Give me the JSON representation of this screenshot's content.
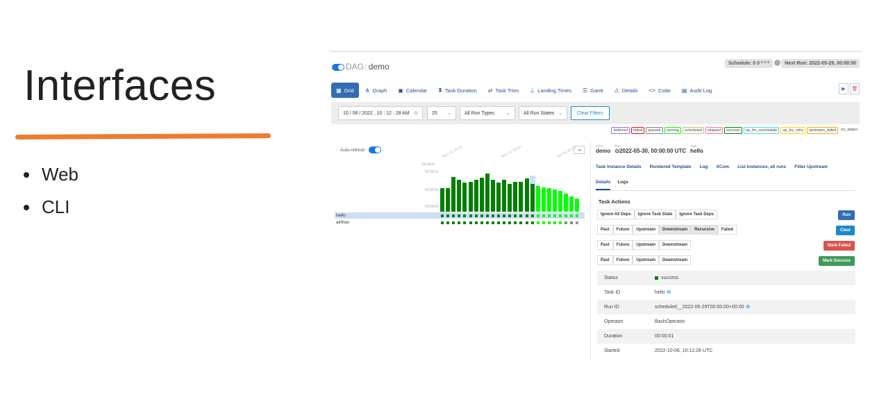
{
  "slide": {
    "title": "Interfaces",
    "bullets": [
      "Web",
      "CLI"
    ],
    "accent_color": "#ec7c30"
  },
  "airflow": {
    "dag_label": "DAG:",
    "dag_name": "demo",
    "schedule": "Schedule: 0 0 * * *",
    "next_run": "Next Run: 2022-05-29, 00:00:00",
    "nav": [
      {
        "label": "Grid",
        "icon": "grid-icon",
        "active": true
      },
      {
        "label": "Graph",
        "icon": "graph-icon"
      },
      {
        "label": "Calendar",
        "icon": "calendar-icon"
      },
      {
        "label": "Task Duration",
        "icon": "hourglass-icon"
      },
      {
        "label": "Task Tries",
        "icon": "retry-icon"
      },
      {
        "label": "Landing Times",
        "icon": "landing-icon"
      },
      {
        "label": "Gantt",
        "icon": "gantt-icon"
      },
      {
        "label": "Details",
        "icon": "warning-icon"
      },
      {
        "label": "Code",
        "icon": "code-icon"
      },
      {
        "label": "Audit Log",
        "icon": "document-icon"
      }
    ],
    "filters": {
      "date": "10 / 06 / 2022 ,  10 : 12 : 28   AM",
      "num_runs": "25",
      "run_type": "All Run Types",
      "run_state": "All Run States",
      "clear": "Clear Filters"
    },
    "legend": [
      "deferred",
      "failed",
      "queued",
      "running",
      "scheduled",
      "skipped",
      "success",
      "up_for_reschedule",
      "up_for_retry",
      "upstream_failed",
      "no_status"
    ],
    "legend_colors": [
      "#9370db",
      "#ff0000",
      "#808080",
      "#00ff00",
      "#d2b48c",
      "#ff69b4",
      "#008000",
      "#40e0d0",
      "#ffd700",
      "#ffa500",
      "#ffffff"
    ],
    "grid": {
      "auto_refresh": "Auto-refresh",
      "duration_label": "Duration",
      "time_labels": [
        "00:00:01",
        "00:00:00",
        "00:00:00"
      ],
      "date_labels": [
        "May 14, 00:00",
        "May 24, 00:00",
        "Jun 03, 00:00"
      ],
      "tasks": [
        "hello",
        "airflow"
      ],
      "run_durations": [
        0.56,
        0.56,
        0.84,
        0.76,
        0.7,
        0.72,
        0.76,
        0.82,
        0.92,
        0.76,
        0.7,
        0.76,
        0.66,
        0.72,
        0.72,
        0.8,
        0.68,
        0.62,
        0.58,
        0.56,
        0.54,
        0.5,
        0.44,
        0.36,
        0.32
      ],
      "run_states": [
        "success",
        "success",
        "success",
        "success",
        "success",
        "success",
        "success",
        "success",
        "success",
        "success",
        "success",
        "success",
        "success",
        "success",
        "success",
        "success",
        "success",
        "running",
        "running",
        "running",
        "running",
        "running",
        "running",
        "running",
        "running"
      ]
    },
    "breadcrumb": {
      "dag_small": "DAG",
      "dag": "demo",
      "run_small": "Run",
      "run": "2022-05-30, 00:00:00 UTC",
      "task_small": "Task",
      "task": "hello"
    },
    "detail_tabs": [
      "Task Instance Details",
      "Rendered Template",
      "Log",
      "XCom",
      "List Instances, all runs",
      "Filter Upstream"
    ],
    "sub_tabs": [
      "Details",
      "Logs"
    ],
    "task_actions_title": "Task Actions",
    "run_row": [
      "Ignore All Deps",
      "Ignore Task State",
      "Ignore Task Deps"
    ],
    "run_button": "Run",
    "clear_row": [
      "Past",
      "Future",
      "Upstream",
      "Downstream",
      "Recursive",
      "Failed"
    ],
    "clear_button": "Clear",
    "failed_row": [
      "Past",
      "Future",
      "Upstream",
      "Downstream"
    ],
    "mark_failed": "Mark Failed",
    "success_row": [
      "Past",
      "Future",
      "Upstream",
      "Downstream"
    ],
    "mark_success": "Mark Success",
    "details": [
      {
        "key": "Status",
        "value": "success"
      },
      {
        "key": "Task ID",
        "value": "hello"
      },
      {
        "key": "Run ID",
        "value": "scheduled__2022-05-29T00:00:00+00:00"
      },
      {
        "key": "Operator",
        "value": "BashOperator"
      },
      {
        "key": "Duration",
        "value": "00:00:01"
      },
      {
        "key": "Started",
        "value": "2022-10-06, 10:12:26 UTC"
      }
    ],
    "colors": {
      "primary": "#336db5",
      "clear": "#1e88c8",
      "danger": "#d9534f",
      "success": "#3f9a58",
      "success_state": "#008000",
      "running_state": "#00ff00"
    }
  }
}
